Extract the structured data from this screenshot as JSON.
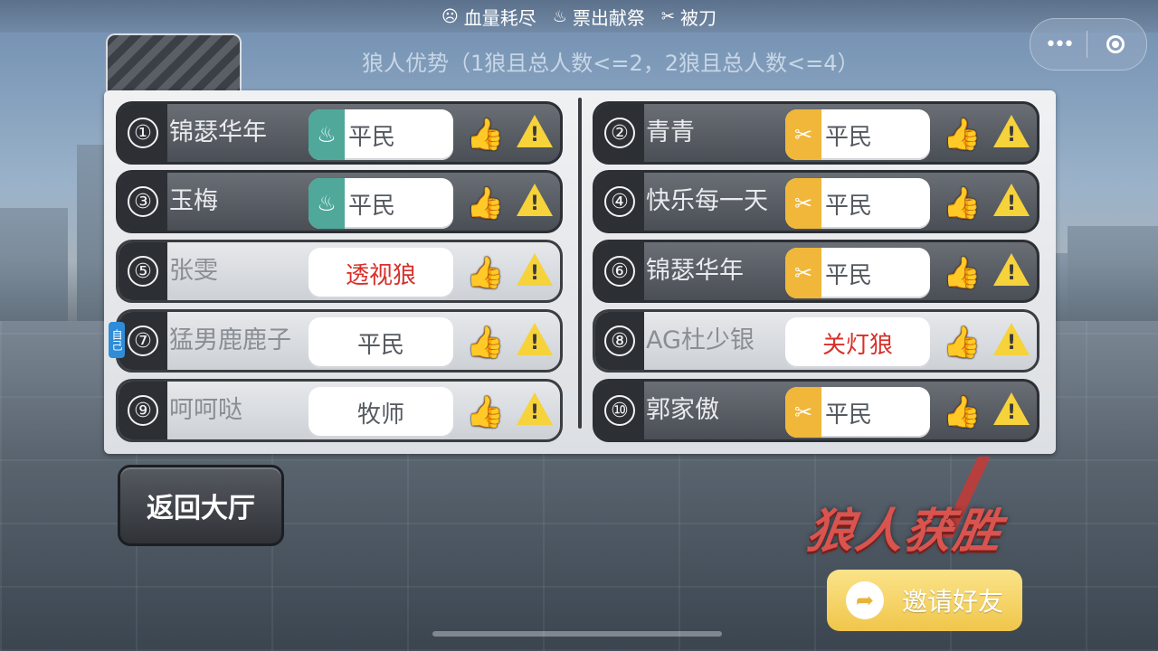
{
  "legend": [
    {
      "icon": "crying-face-icon",
      "glyph": "☹",
      "label": "血量耗尽"
    },
    {
      "icon": "fire-icon",
      "glyph": "♨",
      "label": "票出献祭"
    },
    {
      "icon": "knife-icon",
      "glyph": "✂",
      "label": "被刀"
    }
  ],
  "subtitle": "狼人优势（1狼且总人数<=2，2狼且总人数<=4）",
  "menu_dots": "•••",
  "self_tag": "自己",
  "players": [
    {
      "num": "①",
      "name": "锦瑟华年",
      "role": "平民",
      "badge": "teal",
      "badge_glyph": "♨",
      "wolf": false,
      "style": "dark"
    },
    {
      "num": "②",
      "name": "青青",
      "role": "平民",
      "badge": "gold",
      "badge_glyph": "✂",
      "wolf": false,
      "style": "dark"
    },
    {
      "num": "③",
      "name": "玉梅",
      "role": "平民",
      "badge": "teal",
      "badge_glyph": "♨",
      "wolf": false,
      "style": "dark"
    },
    {
      "num": "④",
      "name": "快乐每一天",
      "role": "平民",
      "badge": "gold",
      "badge_glyph": "✂",
      "wolf": false,
      "style": "dark"
    },
    {
      "num": "⑤",
      "name": "张雯",
      "role": "透视狼",
      "badge": "",
      "badge_glyph": "",
      "wolf": true,
      "style": "light"
    },
    {
      "num": "⑥",
      "name": "锦瑟华年",
      "role": "平民",
      "badge": "gold",
      "badge_glyph": "✂",
      "wolf": false,
      "style": "dark"
    },
    {
      "num": "⑦",
      "name": "猛男鹿鹿子",
      "role": "平民",
      "badge": "",
      "badge_glyph": "",
      "wolf": false,
      "style": "light",
      "self": true
    },
    {
      "num": "⑧",
      "name": "AG杜少银",
      "role": "关灯狼",
      "badge": "",
      "badge_glyph": "",
      "wolf": true,
      "style": "light"
    },
    {
      "num": "⑨",
      "name": "呵呵哒",
      "role": "牧师",
      "badge": "",
      "badge_glyph": "",
      "wolf": false,
      "style": "light"
    },
    {
      "num": "⑩",
      "name": "郭家傲",
      "role": "平民",
      "badge": "gold",
      "badge_glyph": "✂",
      "wolf": false,
      "style": "dark"
    }
  ],
  "back_button": "返回大厅",
  "win_text": "狼人获胜",
  "invite_button": "邀请好友",
  "colors": {
    "wolf_red": "#d7302a",
    "teal": "#4fa89a",
    "gold": "#f0b73a"
  }
}
